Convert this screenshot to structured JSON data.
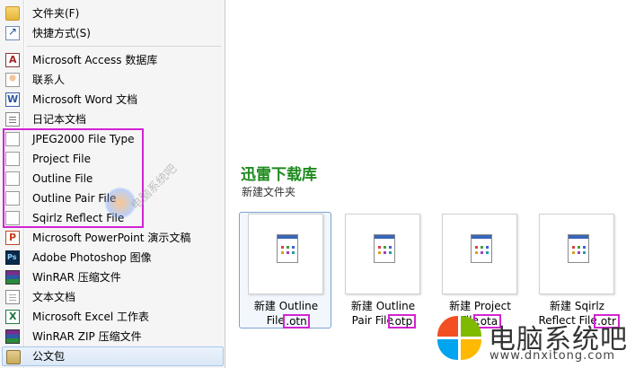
{
  "menu": {
    "items": [
      {
        "label": "文件夹(F)",
        "icon": "folder-icon"
      },
      {
        "label": "快捷方式(S)",
        "icon": "shortcut-icon"
      },
      {
        "label": "Microsoft Access 数据库",
        "icon": "access-icon"
      },
      {
        "label": "联系人",
        "icon": "contact-icon"
      },
      {
        "label": "Microsoft Word 文档",
        "icon": "word-icon"
      },
      {
        "label": "日记本文档",
        "icon": "journal-icon"
      },
      {
        "label": "JPEG2000 File Type",
        "icon": "blank-file-icon"
      },
      {
        "label": "Project File",
        "icon": "blank-file-icon"
      },
      {
        "label": "Outline File",
        "icon": "blank-file-icon"
      },
      {
        "label": "Outline Pair File",
        "icon": "blank-file-icon"
      },
      {
        "label": "Sqirlz Reflect File",
        "icon": "blank-file-icon"
      },
      {
        "label": "Microsoft PowerPoint 演示文稿",
        "icon": "powerpoint-icon"
      },
      {
        "label": "Adobe Photoshop 图像",
        "icon": "photoshop-icon"
      },
      {
        "label": "WinRAR 压缩文件",
        "icon": "winrar-icon"
      },
      {
        "label": "文本文档",
        "icon": "text-doc-icon"
      },
      {
        "label": "Microsoft Excel 工作表",
        "icon": "excel-icon"
      },
      {
        "label": "WinRAR ZIP 压缩文件",
        "icon": "winrar-zip-icon"
      },
      {
        "label": "公文包",
        "icon": "briefcase-icon"
      }
    ]
  },
  "folder": {
    "title": "迅雷下载库",
    "subtitle": "新建文件夹"
  },
  "files": [
    {
      "line1": "新建 Outline",
      "line2_prefix": "File",
      "ext": ".otn"
    },
    {
      "line1": "新建 Outline",
      "line2_prefix": "Pair File",
      "ext": ".otp"
    },
    {
      "line1": "新建 Project",
      "line2_prefix": "File",
      "ext": ".ota"
    },
    {
      "line1": "新建 Sqirlz",
      "line2_prefix": "Reflect File",
      "ext": ".otr"
    }
  ],
  "watermark": {
    "name": "电脑系统吧",
    "url": "www.dnxitong.com",
    "center_text": "电脑系统吧"
  },
  "colors": {
    "highlight_box": "#d224d2",
    "title_green": "#1e8a1e",
    "selection_border": "#7da2ce"
  }
}
